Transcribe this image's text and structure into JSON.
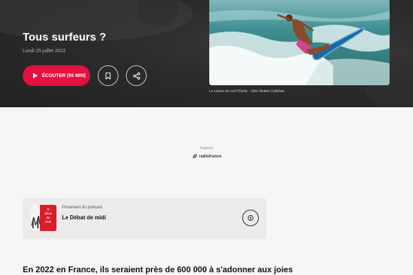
{
  "hero": {
    "title": "Tous surfeurs ?",
    "date": "Lundi 25 juillet 2022",
    "listen_label": "ÉCOUTER (55 MIN)",
    "image_caption": "La culture du surf ©Getty - John Seaton Callahan"
  },
  "ad": {
    "label": "Publicité",
    "brand": "radiofrance"
  },
  "podcast": {
    "from_label": "Provenant du podcast",
    "name": "Le Débat de midi",
    "cover_text": [
      "le",
      "débat",
      "de",
      "midi"
    ]
  },
  "article": {
    "lead": "En 2022 en France, ils seraient près de 600 000 à s'adonner aux joies"
  },
  "colors": {
    "accent": "#e4113f",
    "hero_bg": "#2b2b2b",
    "card_bg": "#ebebeb",
    "cover_bg": "#d91d2b"
  },
  "icons": [
    "play-icon",
    "bookmark-icon",
    "share-icon",
    "radiofrance-logo-icon",
    "podcast-icon"
  ]
}
